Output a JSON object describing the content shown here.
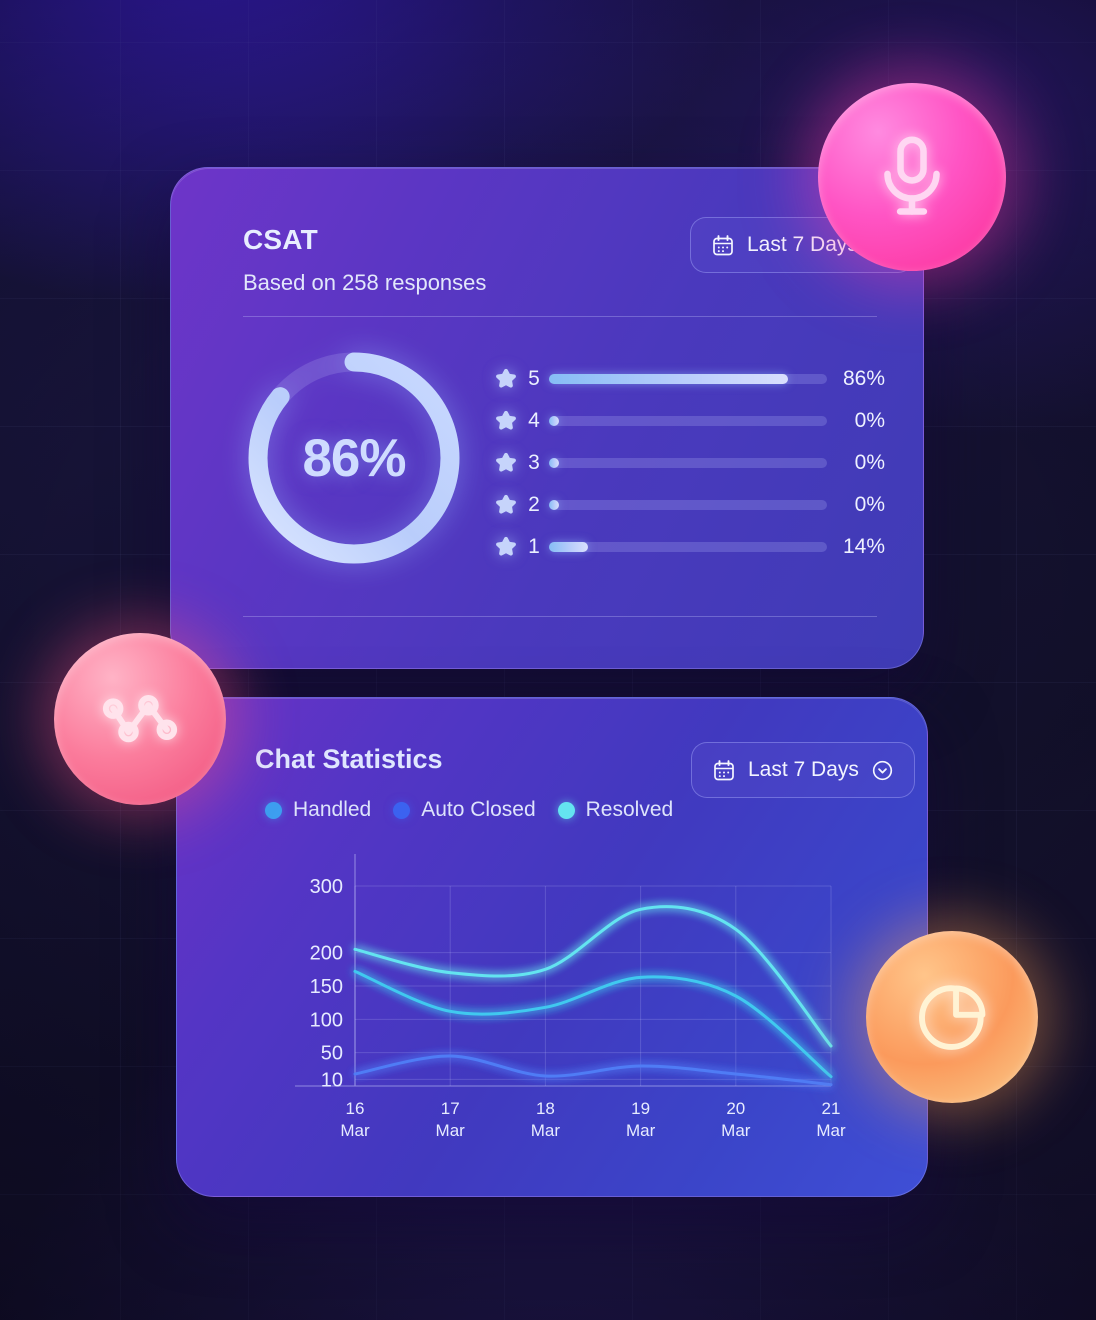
{
  "background": {
    "grid_color": "#96a0e6",
    "base_color": "#14132b"
  },
  "csat": {
    "title": "CSAT",
    "subtitle": "Based on 258 responses",
    "score_label": "86%",
    "score_value": 86,
    "date_filter": {
      "label": "Last 7 Days",
      "calendar_icon": "calendar-icon",
      "chevron_icon": "chevron-down-icon"
    },
    "ratings": [
      {
        "stars": "5",
        "percent_label": "86%",
        "value": 86
      },
      {
        "stars": "4",
        "percent_label": "0%",
        "value": 0
      },
      {
        "stars": "3",
        "percent_label": "0%",
        "value": 0
      },
      {
        "stars": "2",
        "percent_label": "0%",
        "value": 0
      },
      {
        "stars": "1",
        "percent_label": "14%",
        "value": 14
      }
    ]
  },
  "chat": {
    "title": "Chat Statistics",
    "date_filter": {
      "label": "Last 7 Days",
      "calendar_icon": "calendar-icon",
      "chevron_icon": "chevron-down-icon"
    },
    "legend": [
      {
        "label": "Handled",
        "color": "#3d9ef0"
      },
      {
        "label": "Auto Closed",
        "color": "#3b62f0"
      },
      {
        "label": "Resolved",
        "color": "#64e4f0"
      }
    ]
  },
  "chart_data": {
    "type": "line",
    "title": "Chat Statistics",
    "xlabel": "",
    "ylabel": "",
    "grid": true,
    "legend_position": "top-left",
    "x": [
      "16 Mar",
      "17 Mar",
      "18 Mar",
      "19 Mar",
      "20 Mar",
      "21 Mar"
    ],
    "xtick_labels": [
      {
        "day": "16",
        "month": "Mar"
      },
      {
        "day": "17",
        "month": "Mar"
      },
      {
        "day": "18",
        "month": "Mar"
      },
      {
        "day": "19",
        "month": "Mar"
      },
      {
        "day": "20",
        "month": "Mar"
      },
      {
        "day": "21",
        "month": "Mar"
      }
    ],
    "ytick_labels": [
      "300",
      "200",
      "150",
      "100",
      "50",
      "10"
    ],
    "ytick_values": [
      300,
      200,
      150,
      100,
      50,
      10
    ],
    "ylim": [
      0,
      330
    ],
    "series": [
      {
        "name": "Resolved",
        "color": "#64e4f0",
        "values": [
          205,
          170,
          175,
          265,
          235,
          60
        ]
      },
      {
        "name": "Handled",
        "color": "#3fc9ef",
        "values": [
          172,
          112,
          118,
          163,
          135,
          14
        ]
      },
      {
        "name": "Auto Closed",
        "color": "#4f7bf5",
        "values": [
          18,
          45,
          15,
          30,
          18,
          2
        ]
      }
    ]
  },
  "badges": [
    {
      "name": "microphone-badge",
      "icon": "microphone-icon",
      "color_from": "#ff5fd2",
      "color_to": "#ff3ea0"
    },
    {
      "name": "line-chart-badge",
      "icon": "line-chart-icon",
      "color_from": "#ff8fb0",
      "color_to": "#f4577f"
    },
    {
      "name": "pie-chart-badge",
      "icon": "pie-chart-icon",
      "color_from": "#ffb46b",
      "color_to": "#f7d08a"
    }
  ]
}
